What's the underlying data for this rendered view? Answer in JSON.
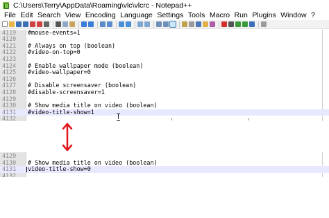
{
  "window": {
    "title": "C:\\Users\\Terry\\AppData\\Roaming\\vlc\\vlcrc - Notepad++"
  },
  "menu": {
    "items": [
      "File",
      "Edit",
      "Search",
      "View",
      "Encoding",
      "Language",
      "Settings",
      "Tools",
      "Macro",
      "Run",
      "Plugins",
      "Window",
      "?"
    ]
  },
  "toolbar": {
    "buttons": [
      {
        "name": "new-file-icon",
        "color": "#ffffff"
      },
      {
        "name": "open-file-icon",
        "color": "#e9b54a"
      },
      {
        "name": "save-icon",
        "color": "#3a6fb5"
      },
      {
        "name": "save-all-icon",
        "color": "#3a6fb5"
      },
      {
        "name": "close-icon",
        "color": "#d04141"
      },
      {
        "name": "close-all-icon",
        "color": "#d04141"
      },
      {
        "name": "print-icon",
        "color": "#666666"
      },
      {
        "name": "sep"
      },
      {
        "name": "cut-icon",
        "color": "#555555"
      },
      {
        "name": "copy-icon",
        "color": "#8fa8c8"
      },
      {
        "name": "paste-icon",
        "color": "#c9a560"
      },
      {
        "name": "sep"
      },
      {
        "name": "undo-icon",
        "color": "#3b7dd8"
      },
      {
        "name": "redo-icon",
        "color": "#3b7dd8"
      },
      {
        "name": "sep"
      },
      {
        "name": "find-icon",
        "color": "#5a8ccc"
      },
      {
        "name": "replace-icon",
        "color": "#5a8ccc"
      },
      {
        "name": "sep"
      },
      {
        "name": "zoom-in-icon",
        "color": "#4a90d9"
      },
      {
        "name": "zoom-out-icon",
        "color": "#4a90d9"
      },
      {
        "name": "sep"
      },
      {
        "name": "sync-vertical-icon",
        "color": "#7fa7cf"
      },
      {
        "name": "sync-horizontal-icon",
        "color": "#7fa7cf"
      },
      {
        "name": "sep"
      },
      {
        "name": "word-wrap-icon",
        "color": "#6d90b8"
      },
      {
        "name": "show-all-chars-icon",
        "color": "#6d90b8"
      },
      {
        "name": "indent-guide-icon",
        "color": "#6d90b8",
        "active": true
      },
      {
        "name": "sep"
      },
      {
        "name": "lang-define-icon",
        "color": "#c0a24a"
      },
      {
        "name": "doc-map-icon",
        "color": "#9b9b9b"
      },
      {
        "name": "function-list-icon",
        "color": "#4b76b8"
      },
      {
        "name": "folder-workspace-icon",
        "color": "#e1b04a"
      },
      {
        "name": "monitoring-icon",
        "color": "#b05ba8"
      },
      {
        "name": "sep"
      },
      {
        "name": "record-macro-icon",
        "color": "#d02f2f"
      },
      {
        "name": "stop-record-icon",
        "color": "#555555"
      },
      {
        "name": "playback-icon",
        "color": "#3a9a3a"
      },
      {
        "name": "run-multiple-icon",
        "color": "#3a9a3a"
      },
      {
        "name": "save-macro-icon",
        "color": "#3a6fb5"
      },
      {
        "name": "sep"
      },
      {
        "name": "extra-icon",
        "color": "#9b9b9b"
      }
    ]
  },
  "editor_top": {
    "lines": [
      {
        "num": "4119",
        "text": "#mouse-events=1"
      },
      {
        "num": "4120",
        "text": ""
      },
      {
        "num": "4121",
        "text": "# Always on top (boolean)"
      },
      {
        "num": "4122",
        "text": "#video-on-top=0"
      },
      {
        "num": "4123",
        "text": ""
      },
      {
        "num": "4124",
        "text": "# Enable wallpaper mode (boolean)"
      },
      {
        "num": "4125",
        "text": "#video-wallpaper=0"
      },
      {
        "num": "4126",
        "text": ""
      },
      {
        "num": "4127",
        "text": "# Disable screensaver (boolean)"
      },
      {
        "num": "4128",
        "text": "#disable-screensaver=1"
      },
      {
        "num": "4129",
        "text": ""
      },
      {
        "num": "4130",
        "text": "# Show media title on video (boolean)"
      },
      {
        "num": "4131",
        "text": "#video-title-show=1",
        "current": true
      },
      {
        "num": "4132",
        "text": ""
      }
    ]
  },
  "editor_bottom": {
    "lines": [
      {
        "num": "4129",
        "text": ""
      },
      {
        "num": "4130",
        "text": "# Show media title on video (boolean)"
      },
      {
        "num": "4131",
        "text": "video-title-show=0",
        "current": true,
        "caret": true
      },
      {
        "num": "4132",
        "text": ""
      }
    ]
  },
  "annotation": {
    "arrow_color": "#e0151c"
  }
}
